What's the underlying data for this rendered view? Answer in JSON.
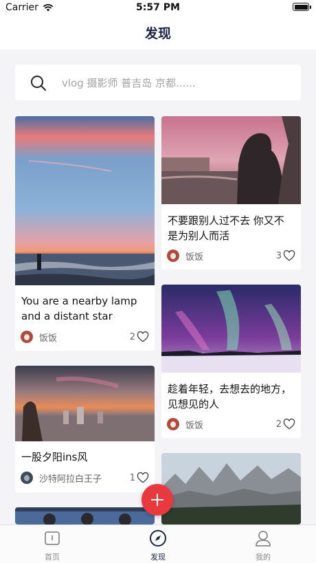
{
  "status_bar": {
    "carrier": "Carrier",
    "time": "5:57 PM"
  },
  "nav": {
    "title": "发现"
  },
  "search": {
    "placeholder": "vlog 摄影师 普吉岛 京都......"
  },
  "cards": [
    {
      "title": "You are a nearby lamp and a distant star",
      "user": "饭饭",
      "likes": "2"
    },
    {
      "title": "不要跟别人过不去  你又不是为别人而活",
      "user": "饭饭",
      "likes": "3"
    },
    {
      "title": "趁着年轻，去想去的地方，见想见的人",
      "user": "饭饭",
      "likes": "2"
    },
    {
      "title": "一股夕阳ins风",
      "user": "沙特阿拉白王子",
      "likes": "1"
    }
  ],
  "tabs": [
    {
      "label": "首页",
      "icon": "home-icon"
    },
    {
      "label": "发现",
      "icon": "compass-icon",
      "active": true
    },
    {
      "label": "我的",
      "icon": "user-icon"
    }
  ],
  "colors": {
    "accent": "#e8393e",
    "nav_text": "#1b2340"
  }
}
